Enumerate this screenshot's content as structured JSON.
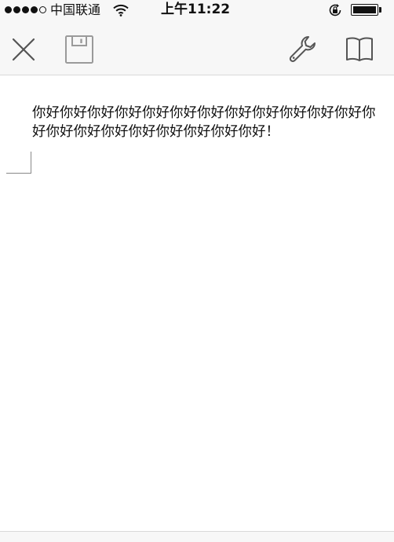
{
  "status_bar": {
    "carrier": "中国联通",
    "time": "上午11:22",
    "signal_bars": 4,
    "signal_total": 5,
    "battery_level": 1.0,
    "icons": [
      "wifi-icon",
      "rotation-lock-icon",
      "battery-icon"
    ]
  },
  "toolbar": {
    "icons": [
      "close-icon",
      "save-icon",
      "settings-wrench-icon",
      "book-icon"
    ]
  },
  "document": {
    "body_text": "你好你好你好你好你好你好你好你好你好你好你好你好你好你好你好你好你好你好你好你好你好！"
  },
  "colors": {
    "bar_background": "#f7f7f7",
    "icon_dark": "#555555",
    "icon_disabled": "#9a9a9a",
    "text": "#111111"
  }
}
